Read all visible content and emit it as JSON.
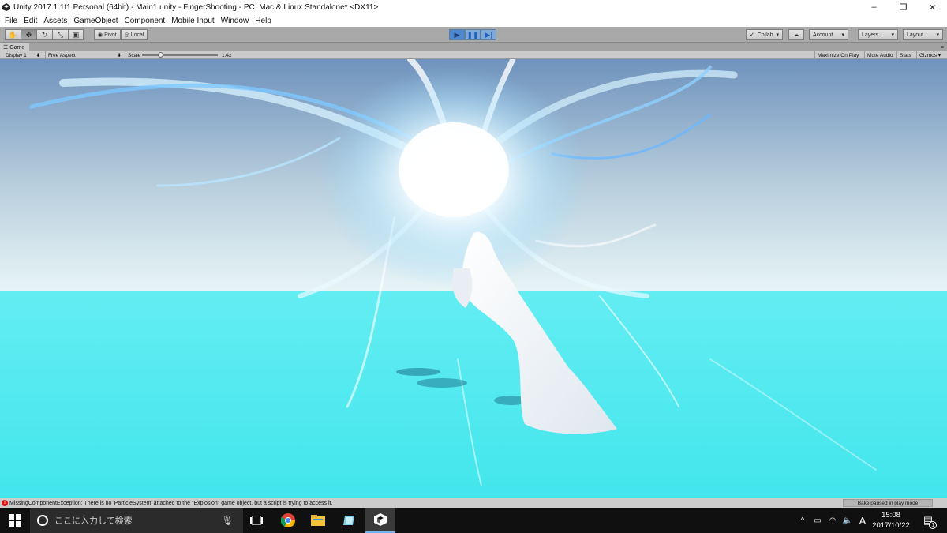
{
  "window": {
    "title": "Unity 2017.1.1f1 Personal (64bit) - Main1.unity - FingerShooting - PC, Mac & Linux Standalone* <DX11>",
    "minimize": "–",
    "restore": "❐",
    "close": "✕"
  },
  "menu": [
    "File",
    "Edit",
    "Assets",
    "GameObject",
    "Component",
    "Mobile Input",
    "Window",
    "Help"
  ],
  "toolbar": {
    "pivot_label": "Pivot",
    "local_label": "Local",
    "collab_label": "Collab",
    "account_label": "Account",
    "layers_label": "Layers",
    "layout_label": "Layout",
    "play_state": "playing"
  },
  "game_view": {
    "tab_label": "Game",
    "display": "Display 1",
    "aspect": "Free Aspect",
    "scale_label": "Scale",
    "scale_value": "1.4x",
    "maximize_on_play": "Maximize On Play",
    "mute_audio": "Mute Audio",
    "stats": "Stats",
    "gizmos": "Gizmos"
  },
  "status": {
    "error_message": "MissingComponentException: There is no 'ParticleSystem' attached to the \"Explosion\" game object, but a script is trying to access it.",
    "paused_label": "Bake paused in play mode"
  },
  "taskbar": {
    "search_placeholder": "ここに入力して検索",
    "time": "15:08",
    "date": "2017/10/22",
    "ime_label": "A",
    "notification_count": "1"
  },
  "colors": {
    "sky_top": "#6f93bd",
    "horizon": "#e6f4f7",
    "ground": "#4fe9ef",
    "glow": "#ffffff"
  }
}
